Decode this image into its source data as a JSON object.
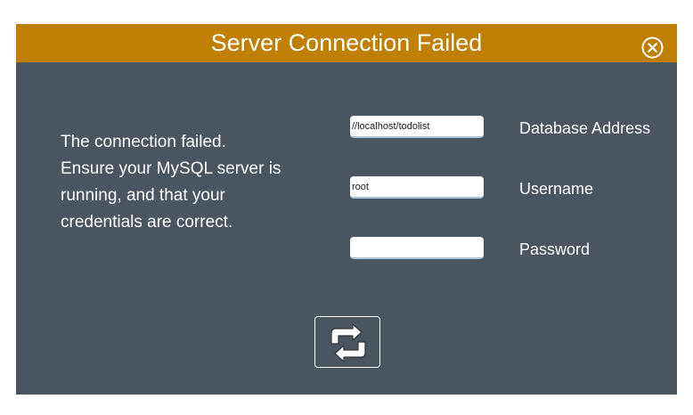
{
  "dialog": {
    "title": "Server Connection Failed",
    "close_icon": "close-circle-icon",
    "message_lines": [
      "The connection failed.",
      "Ensure your MySQL server is",
      "running, and that your",
      "credentials are correct."
    ],
    "fields": {
      "database_address": {
        "label": "Database Address",
        "value": "//localhost/todolist"
      },
      "username": {
        "label": "Username",
        "value": "root"
      },
      "password": {
        "label": "Password",
        "value": ""
      }
    },
    "retry_icon": "refresh-icon"
  },
  "colors": {
    "title_bar": "#c17f00",
    "panel_background": "#4a5560",
    "text": "#ffffff"
  }
}
